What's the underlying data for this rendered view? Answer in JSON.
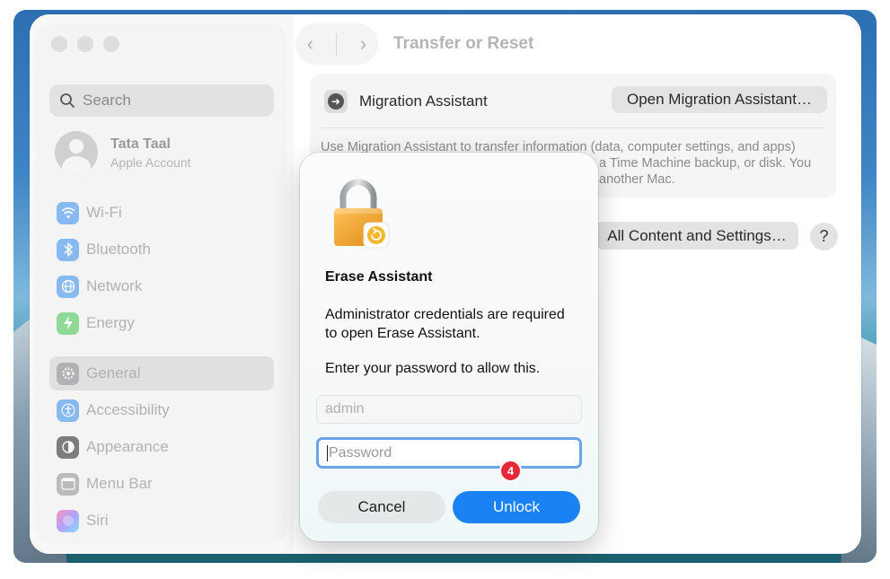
{
  "window": {
    "title": "Transfer or Reset"
  },
  "sidebar": {
    "search_placeholder": "Search",
    "account": {
      "name": "Tata Taal",
      "subtitle": "Apple Account"
    },
    "group1": [
      {
        "label": "Wi-Fi",
        "icon": "wifi-icon",
        "color": "#2f8cf0"
      },
      {
        "label": "Bluetooth",
        "icon": "bluetooth-icon",
        "color": "#2f8cf0"
      },
      {
        "label": "Network",
        "icon": "globe-icon",
        "color": "#2f8cf0"
      },
      {
        "label": "Energy",
        "icon": "bolt-icon",
        "color": "#3cc44a"
      }
    ],
    "group2": [
      {
        "label": "General",
        "icon": "gear-icon",
        "color": "#8e8e93",
        "selected": true
      },
      {
        "label": "Accessibility",
        "icon": "accessibility-icon",
        "color": "#2f8cf0"
      },
      {
        "label": "Appearance",
        "icon": "appearance-icon",
        "color": "#1d1d1f"
      },
      {
        "label": "Menu Bar",
        "icon": "menubar-icon",
        "color": "#8e8e93"
      },
      {
        "label": "Siri",
        "icon": "siri-icon",
        "color": "#b14ee8"
      }
    ]
  },
  "content": {
    "migration": {
      "title": "Migration Assistant",
      "button": "Open Migration Assistant…",
      "description_line1": "Use Migration Assistant to transfer information (data, computer settings, and apps)",
      "description_line2": "a Time Machine backup, or disk. You",
      "description_line3": "another Mac."
    },
    "erase_button": "All Content and Settings…",
    "help_label": "?"
  },
  "dialog": {
    "title": "Erase Assistant",
    "message": "Administrator credentials are required to open Erase Assistant.",
    "prompt": "Enter your password to allow this.",
    "username_value": "admin",
    "password_placeholder": "Password",
    "cancel_label": "Cancel",
    "unlock_label": "Unlock",
    "step_badge": "4"
  },
  "colors": {
    "accent": "#1a82f5",
    "badge": "#e8283a"
  }
}
